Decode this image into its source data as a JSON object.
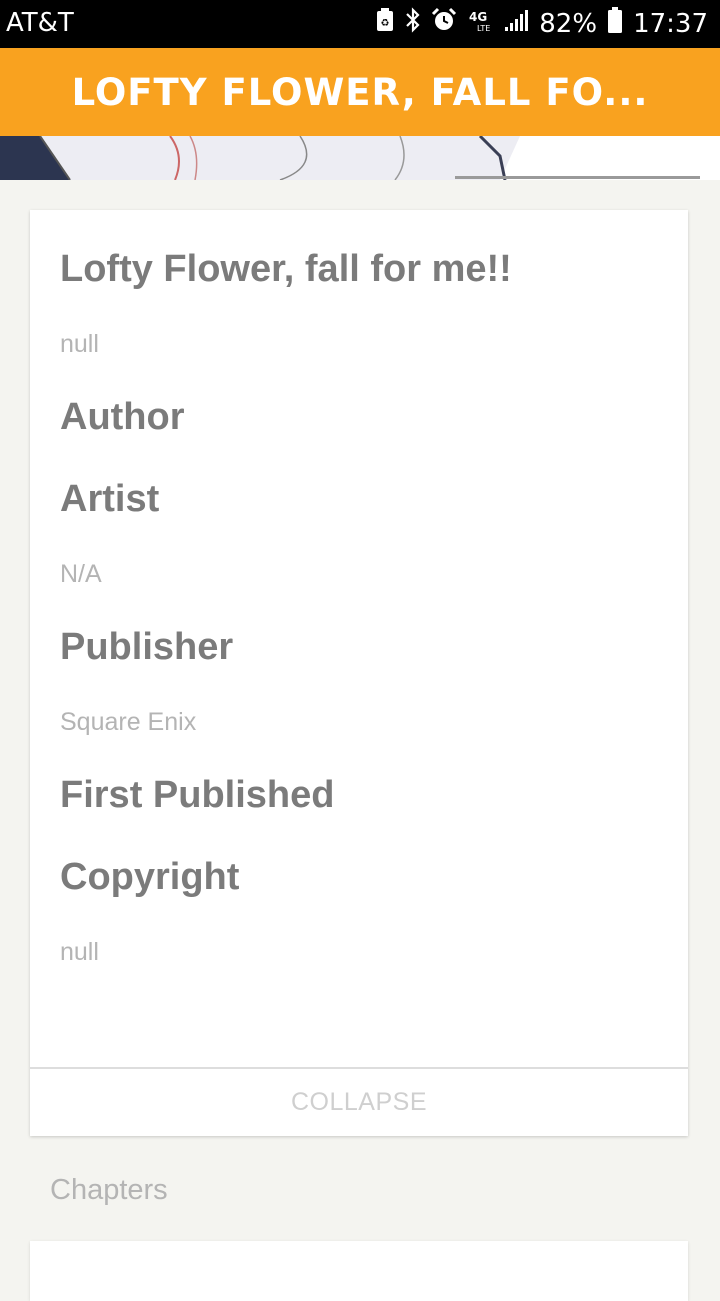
{
  "status_bar": {
    "carrier": "AT&T",
    "battery_percent": "82%",
    "time": "17:37",
    "icons": [
      "battery-saver-icon",
      "bluetooth-icon",
      "alarm-icon",
      "4g-lte-icon",
      "signal-icon",
      "battery-icon"
    ]
  },
  "app_bar": {
    "title": "LOFTY FLOWER, FALL FO...",
    "color": "#f9a21f"
  },
  "details": {
    "title": "Lofty Flower, fall for me!!",
    "description": "null",
    "author_label": "Author",
    "artist_label": "Artist",
    "artist_value": "N/A",
    "publisher_label": "Publisher",
    "publisher_value": "Square Enix",
    "first_published_label": "First Published",
    "copyright_label": "Copyright",
    "copyright_value": "null",
    "collapse_label": "COLLAPSE"
  },
  "chapters": {
    "header": "Chapters"
  }
}
